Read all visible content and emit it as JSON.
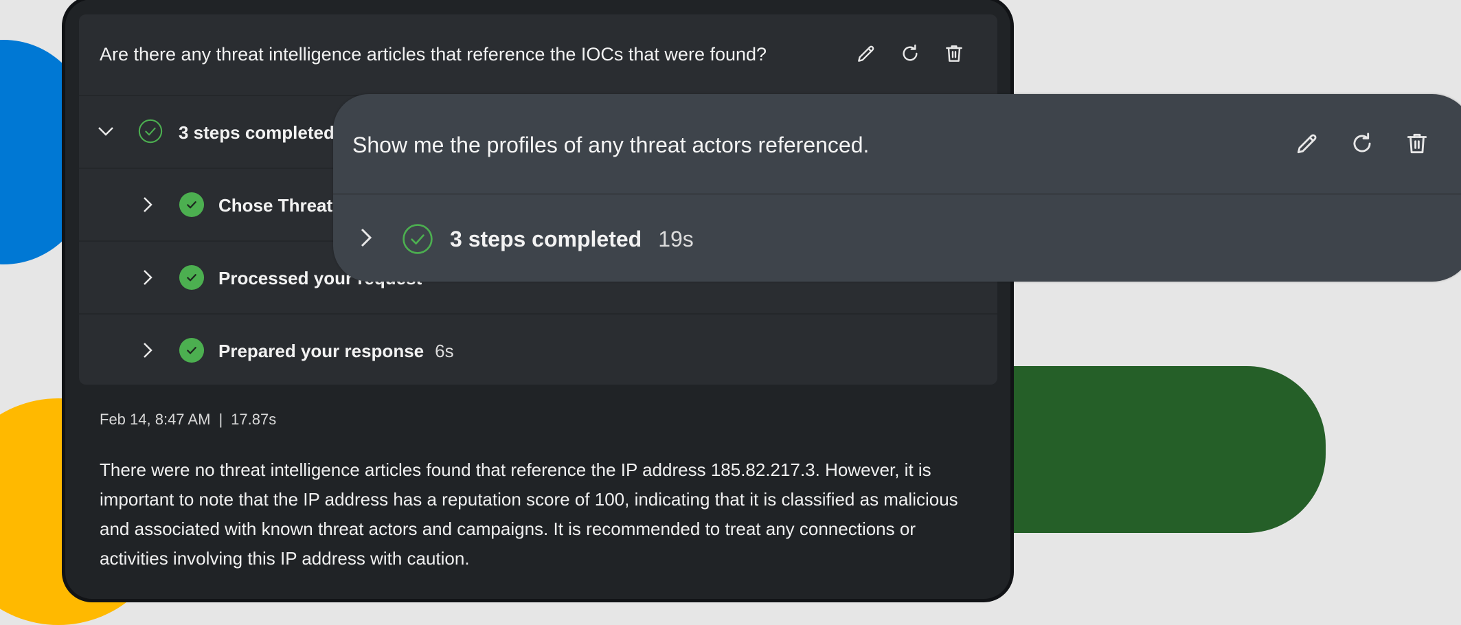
{
  "main_card": {
    "question": "Are there any threat intelligence articles that reference the IOCs that were found?",
    "actions": [
      {
        "name": "edit",
        "icon": "pencil-icon"
      },
      {
        "name": "retry",
        "icon": "refresh-icon"
      },
      {
        "name": "delete",
        "icon": "trash-icon"
      }
    ],
    "summary": {
      "label": "3 steps completed",
      "expanded": true,
      "icon": "check-circle-outline-icon"
    },
    "steps": [
      {
        "label": "Chose Threat",
        "time": ""
      },
      {
        "label": "Processed your request",
        "time": ""
      },
      {
        "label": "Prepared your response",
        "time": "6s"
      }
    ],
    "meta": {
      "date": "Feb 14, 8:47 AM",
      "separator": "|",
      "duration": "17.87s"
    },
    "response": "There were no threat intelligence articles found that reference the IP address 185.82.217.3. However, it is important to note that the IP address has a reputation score of 100, indicating that it is classified as malicious and associated with known threat actors and campaigns. It is recommended to treat any connections or activities involving this IP address with caution."
  },
  "overlay_card": {
    "question": "Show me the profiles of any threat actors referenced.",
    "summary": {
      "label": "3 steps completed",
      "time": "19s",
      "expanded": false
    }
  },
  "colors": {
    "success_green": "#4caf50",
    "background": "#e6e6e6",
    "card_bg": "#202326",
    "panel_bg": "#2a2d31",
    "overlay_bg": "#3e444b",
    "deco_blue": "#0078d4",
    "deco_yellow": "#ffb900",
    "deco_green": "#255f28"
  }
}
